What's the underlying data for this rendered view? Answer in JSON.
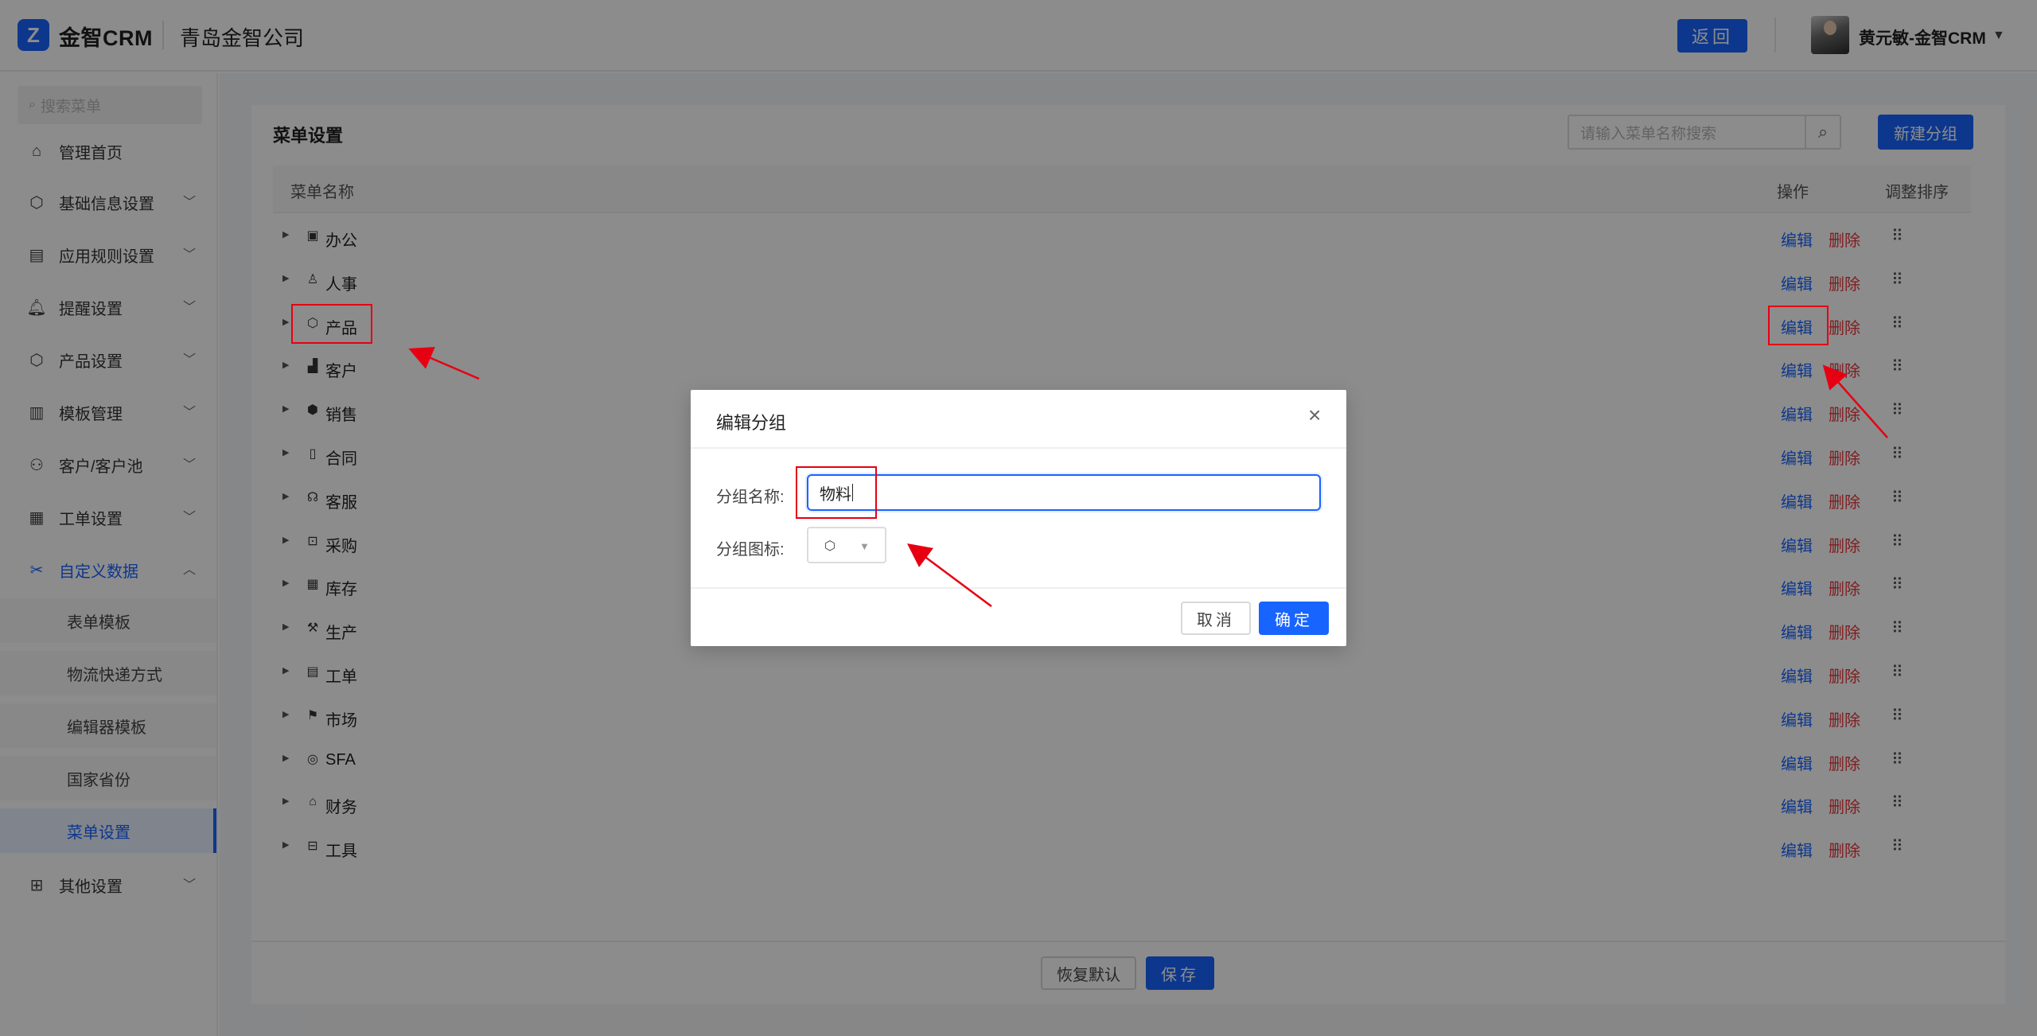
{
  "header": {
    "logo_mark": "Z",
    "logo_text": "金智CRM",
    "company": "青岛金智公司",
    "back_label": "返回",
    "user_name": "黄元敏-金智CRM",
    "caret": "▼"
  },
  "sidebar": {
    "search_placeholder": "搜索菜单",
    "items": [
      {
        "label": "管理首页",
        "icon": "home-icon",
        "glyph": "⌂",
        "expandable": false
      },
      {
        "label": "基础信息设置",
        "icon": "cube-icon",
        "glyph": "⬡",
        "expandable": true
      },
      {
        "label": "应用规则设置",
        "icon": "document-icon",
        "glyph": "▤",
        "expandable": true
      },
      {
        "label": "提醒设置",
        "icon": "bell-icon",
        "glyph": "🔔︎",
        "expandable": true
      },
      {
        "label": "产品设置",
        "icon": "box-icon",
        "glyph": "⬡",
        "expandable": true
      },
      {
        "label": "模板管理",
        "icon": "layout-icon",
        "glyph": "▥",
        "expandable": true
      },
      {
        "label": "客户/客户池",
        "icon": "users-icon",
        "glyph": "⚇",
        "expandable": true
      },
      {
        "label": "工单设置",
        "icon": "ticket-icon",
        "glyph": "▦",
        "expandable": true
      },
      {
        "label": "自定义数据",
        "icon": "tools-icon",
        "glyph": "✂",
        "expandable": true,
        "expanded": true
      },
      {
        "label": "其他设置",
        "icon": "grid-icon",
        "glyph": "⊞",
        "expandable": true
      }
    ],
    "sub_items": [
      "表单模板",
      "物流快递方式",
      "编辑器模板",
      "国家省份",
      "菜单设置"
    ],
    "current_sub": "菜单设置"
  },
  "main": {
    "title": "菜单设置",
    "search_placeholder": "请输入菜单名称搜索",
    "new_group_label": "新建分组",
    "columns": {
      "name": "菜单名称",
      "op": "操作",
      "sort": "调整排序"
    },
    "rows": [
      {
        "name": "办公",
        "icon": "printer-icon",
        "glyph": "▣"
      },
      {
        "name": "人事",
        "icon": "person-icon",
        "glyph": "♙"
      },
      {
        "name": "产品",
        "icon": "box-icon",
        "glyph": "⬡"
      },
      {
        "name": "客户",
        "icon": "chart-icon",
        "glyph": "▟"
      },
      {
        "name": "销售",
        "icon": "hexagon-icon",
        "glyph": "⬢"
      },
      {
        "name": "合同",
        "icon": "contract-icon",
        "glyph": "▯"
      },
      {
        "name": "客服",
        "icon": "headset-icon",
        "glyph": "☊"
      },
      {
        "name": "采购",
        "icon": "bag-icon",
        "glyph": "⊡"
      },
      {
        "name": "库存",
        "icon": "warehouse-icon",
        "glyph": "▦"
      },
      {
        "name": "生产",
        "icon": "factory-icon",
        "glyph": "⚒"
      },
      {
        "name": "工单",
        "icon": "ticket-icon",
        "glyph": "▤"
      },
      {
        "name": "市场",
        "icon": "flag-icon",
        "glyph": "⚑"
      },
      {
        "name": "SFA",
        "icon": "target-icon",
        "glyph": "◎"
      },
      {
        "name": "财务",
        "icon": "bank-icon",
        "glyph": "⌂"
      },
      {
        "name": "工具",
        "icon": "toolbox-icon",
        "glyph": "⊟"
      }
    ],
    "edit_label": "编辑",
    "delete_label": "删除",
    "drag_glyph": "⠿",
    "row_caret": "▶",
    "restore_label": "恢复默认",
    "save_label": "保存"
  },
  "modal": {
    "title": "编辑分组",
    "close": "×",
    "name_label": "分组名称:",
    "name_value": "物料",
    "icon_label": "分组图标:",
    "icon_glyph": "⬡",
    "icon_caret": "▼",
    "cancel_label": "取消",
    "ok_label": "确定"
  },
  "colors": {
    "accent": "#1864ff",
    "danger": "#e8353b",
    "annotation": "#e60012"
  }
}
